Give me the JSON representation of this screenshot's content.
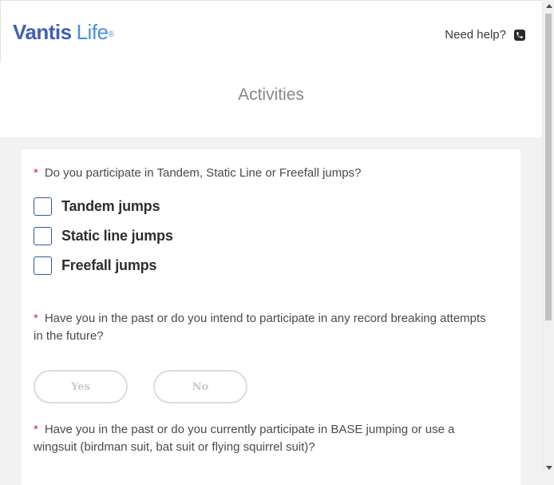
{
  "header": {
    "logo_primary": "Vantis",
    "logo_secondary": "Life",
    "logo_mark": "®",
    "help_label": "Need help?",
    "help_icon": "phone-icon"
  },
  "page": {
    "title": "Activities"
  },
  "questions": {
    "q1": {
      "required_mark": "*",
      "text": "Do you participate in Tandem, Static Line or Freefall jumps?",
      "options": [
        {
          "label": "Tandem jumps",
          "checked": false
        },
        {
          "label": "Static line jumps",
          "checked": false
        },
        {
          "label": "Freefall jumps",
          "checked": false
        }
      ]
    },
    "q2": {
      "required_mark": "*",
      "text": "Have you in the past or do you intend to participate in any record breaking attempts in the future?",
      "yes_label": "Yes",
      "no_label": "No"
    },
    "q3": {
      "required_mark": "*",
      "text": "Have you in the past or do you currently participate in BASE jumping or use a wingsuit (birdman suit, bat suit or flying squirrel suit)?"
    }
  },
  "colors": {
    "brand_primary": "#3f5fb5",
    "brand_secondary": "#4a90d9",
    "required": "#e0202a",
    "checkbox_border": "#2d5a9e"
  }
}
